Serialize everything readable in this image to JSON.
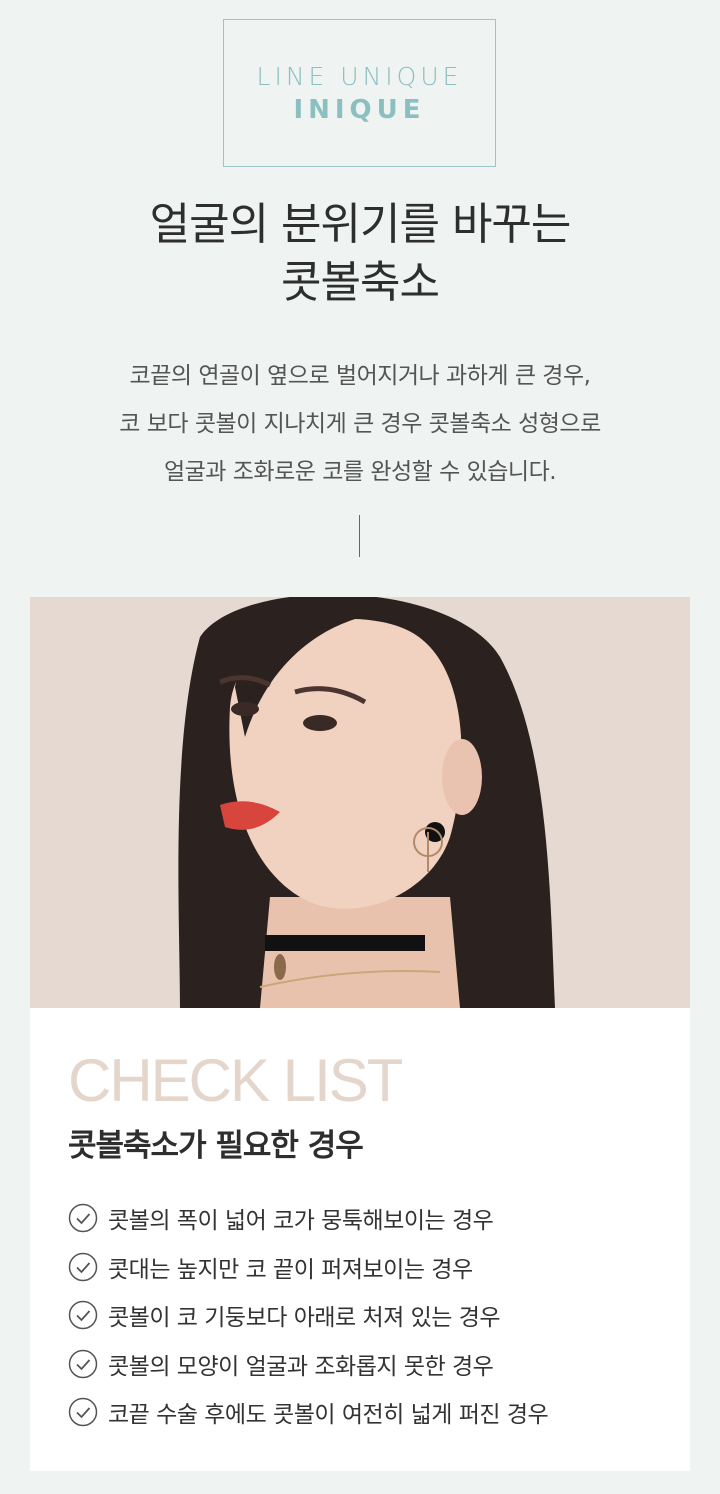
{
  "logo": {
    "line1": "LINE UNIQUE",
    "line2": "INIQUE"
  },
  "headline": {
    "line1": "얼굴의 분위기를 바꾸는",
    "line2": "콧볼축소"
  },
  "description": {
    "line1": "코끝의 연골이 옆으로 벌어지거나 과하게 큰 경우,",
    "line2": "코 보다 콧볼이 지나치게 큰 경우 콧볼축소 성형으로",
    "line3": "얼굴과 조화로운 코를 완성할 수 있습니다."
  },
  "checklist": {
    "title": "CHECK LIST",
    "subtitle": "콧볼축소가 필요한 경우",
    "items": [
      "콧볼의 폭이 넓어 코가 뭉툭해보이는 경우",
      "콧대는 높지만 코 끝이 퍼져보이는 경우",
      "콧볼이 코 기둥보다 아래로 처져 있는 경우",
      "콧볼의 모양이 얼굴과 조화롭지 못한 경우",
      "코끝 수술 후에도 콧볼이 여전히 넓게 퍼진 경우"
    ]
  },
  "icons": {
    "check": "check-circle-icon"
  },
  "colors": {
    "background": "#eff3f1",
    "accent": "#8cbfc0",
    "checklistTitle": "#e5d6cc",
    "photoBackground": "#e5d9d1"
  }
}
